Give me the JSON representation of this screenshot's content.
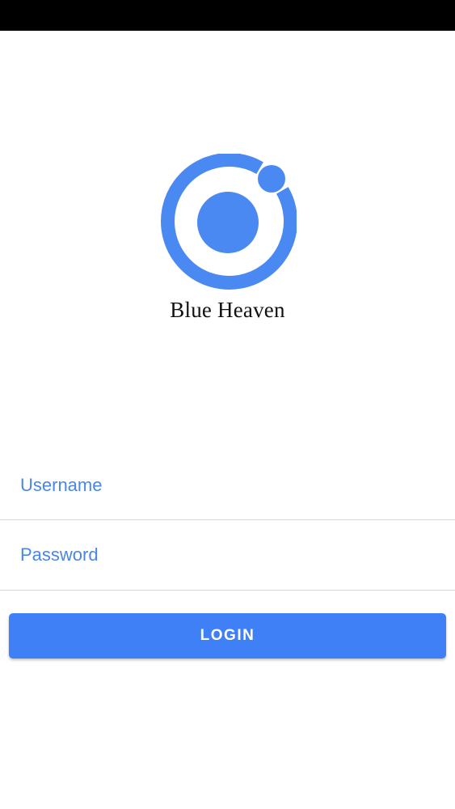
{
  "app": {
    "brand_name": "Blue Heaven",
    "logo_icon": "ionic-logo-icon",
    "accent_color": "#3f80f7"
  },
  "login_form": {
    "username_placeholder": "Username",
    "password_placeholder": "Password",
    "login_label": "LOGIN"
  }
}
